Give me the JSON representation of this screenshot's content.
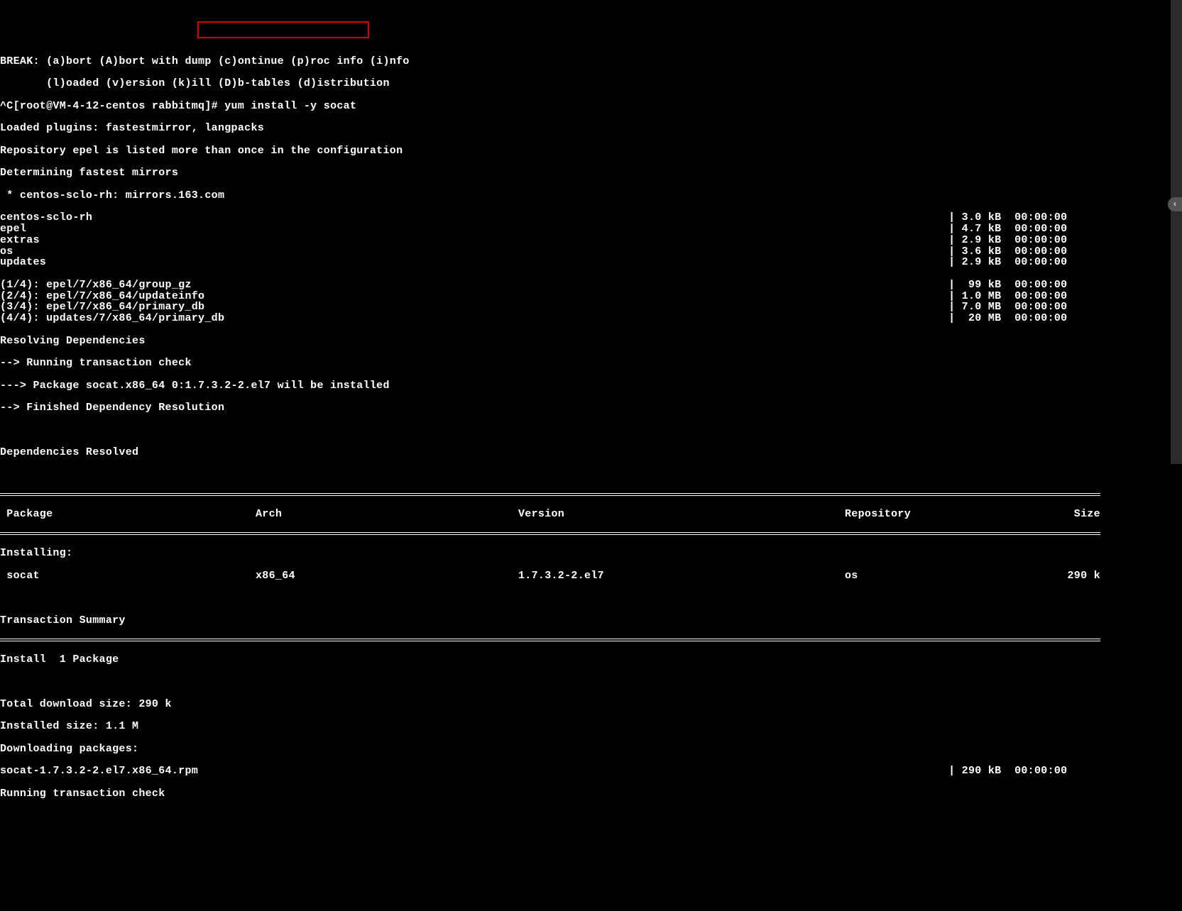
{
  "lines": {
    "break": "BREAK: (a)bort (A)bort with dump (c)ontinue (p)roc info (i)nfo",
    "break2": "       (l)oaded (v)ersion (k)ill (D)b-tables (d)istribution",
    "prompt_prefix": "^C[root@VM-4-12-centos rabbitmq]# ",
    "command": "yum install -y socat",
    "loaded_plugins": "Loaded plugins: fastestmirror, langpacks",
    "repo_epel": "Repository epel is listed more than once in the configuration",
    "det_mirrors": "Determining fastest mirrors",
    "mirror": " * centos-sclo-rh: mirrors.163.com",
    "resolving": "Resolving Dependencies",
    "runcheck": "--> Running transaction check",
    "pkginst": "---> Package socat.x86_64 0:1.7.3.2-2.el7 will be installed",
    "finres": "--> Finished Dependency Resolution",
    "depres": "Dependencies Resolved",
    "installing": "Installing:",
    "tsummary": "Transaction Summary",
    "install1": "Install  1 Package",
    "totaldl": "Total download size: 290 k",
    "instsize": "Installed size: 1.1 M",
    "dlpkgs": "Downloading packages:",
    "runtcheck": "Running transaction check"
  },
  "repos": [
    {
      "name": "centos-sclo-rh",
      "size": "3.0 kB",
      "time": "00:00:00"
    },
    {
      "name": "epel",
      "size": "4.7 kB",
      "time": "00:00:00"
    },
    {
      "name": "extras",
      "size": "2.9 kB",
      "time": "00:00:00"
    },
    {
      "name": "os",
      "size": "3.6 kB",
      "time": "00:00:00"
    },
    {
      "name": "updates",
      "size": "2.9 kB",
      "time": "00:00:00"
    }
  ],
  "downloads": [
    {
      "label": "(1/4): epel/7/x86_64/group_gz",
      "size": " 99 kB",
      "time": "00:00:00"
    },
    {
      "label": "(2/4): epel/7/x86_64/updateinfo",
      "size": "1.0 MB",
      "time": "00:00:00"
    },
    {
      "label": "(3/4): epel/7/x86_64/primary_db",
      "size": "7.0 MB",
      "time": "00:00:00"
    },
    {
      "label": "(4/4): updates/7/x86_64/primary_db",
      "size": " 20 MB",
      "time": "00:00:00"
    }
  ],
  "table": {
    "headers": {
      "pkg": " Package",
      "arch": "Arch",
      "ver": "Version",
      "repo": "Repository",
      "size": "Size"
    },
    "row": {
      "pkg": " socat",
      "arch": "x86_64",
      "ver": "1.7.3.2-2.el7",
      "repo": "os",
      "size": "290 k"
    }
  },
  "rpm": {
    "name": "socat-1.7.3.2-2.el7.x86_64.rpm",
    "size": "290 kB",
    "time": "00:00:00"
  },
  "side_arrow": "‹"
}
